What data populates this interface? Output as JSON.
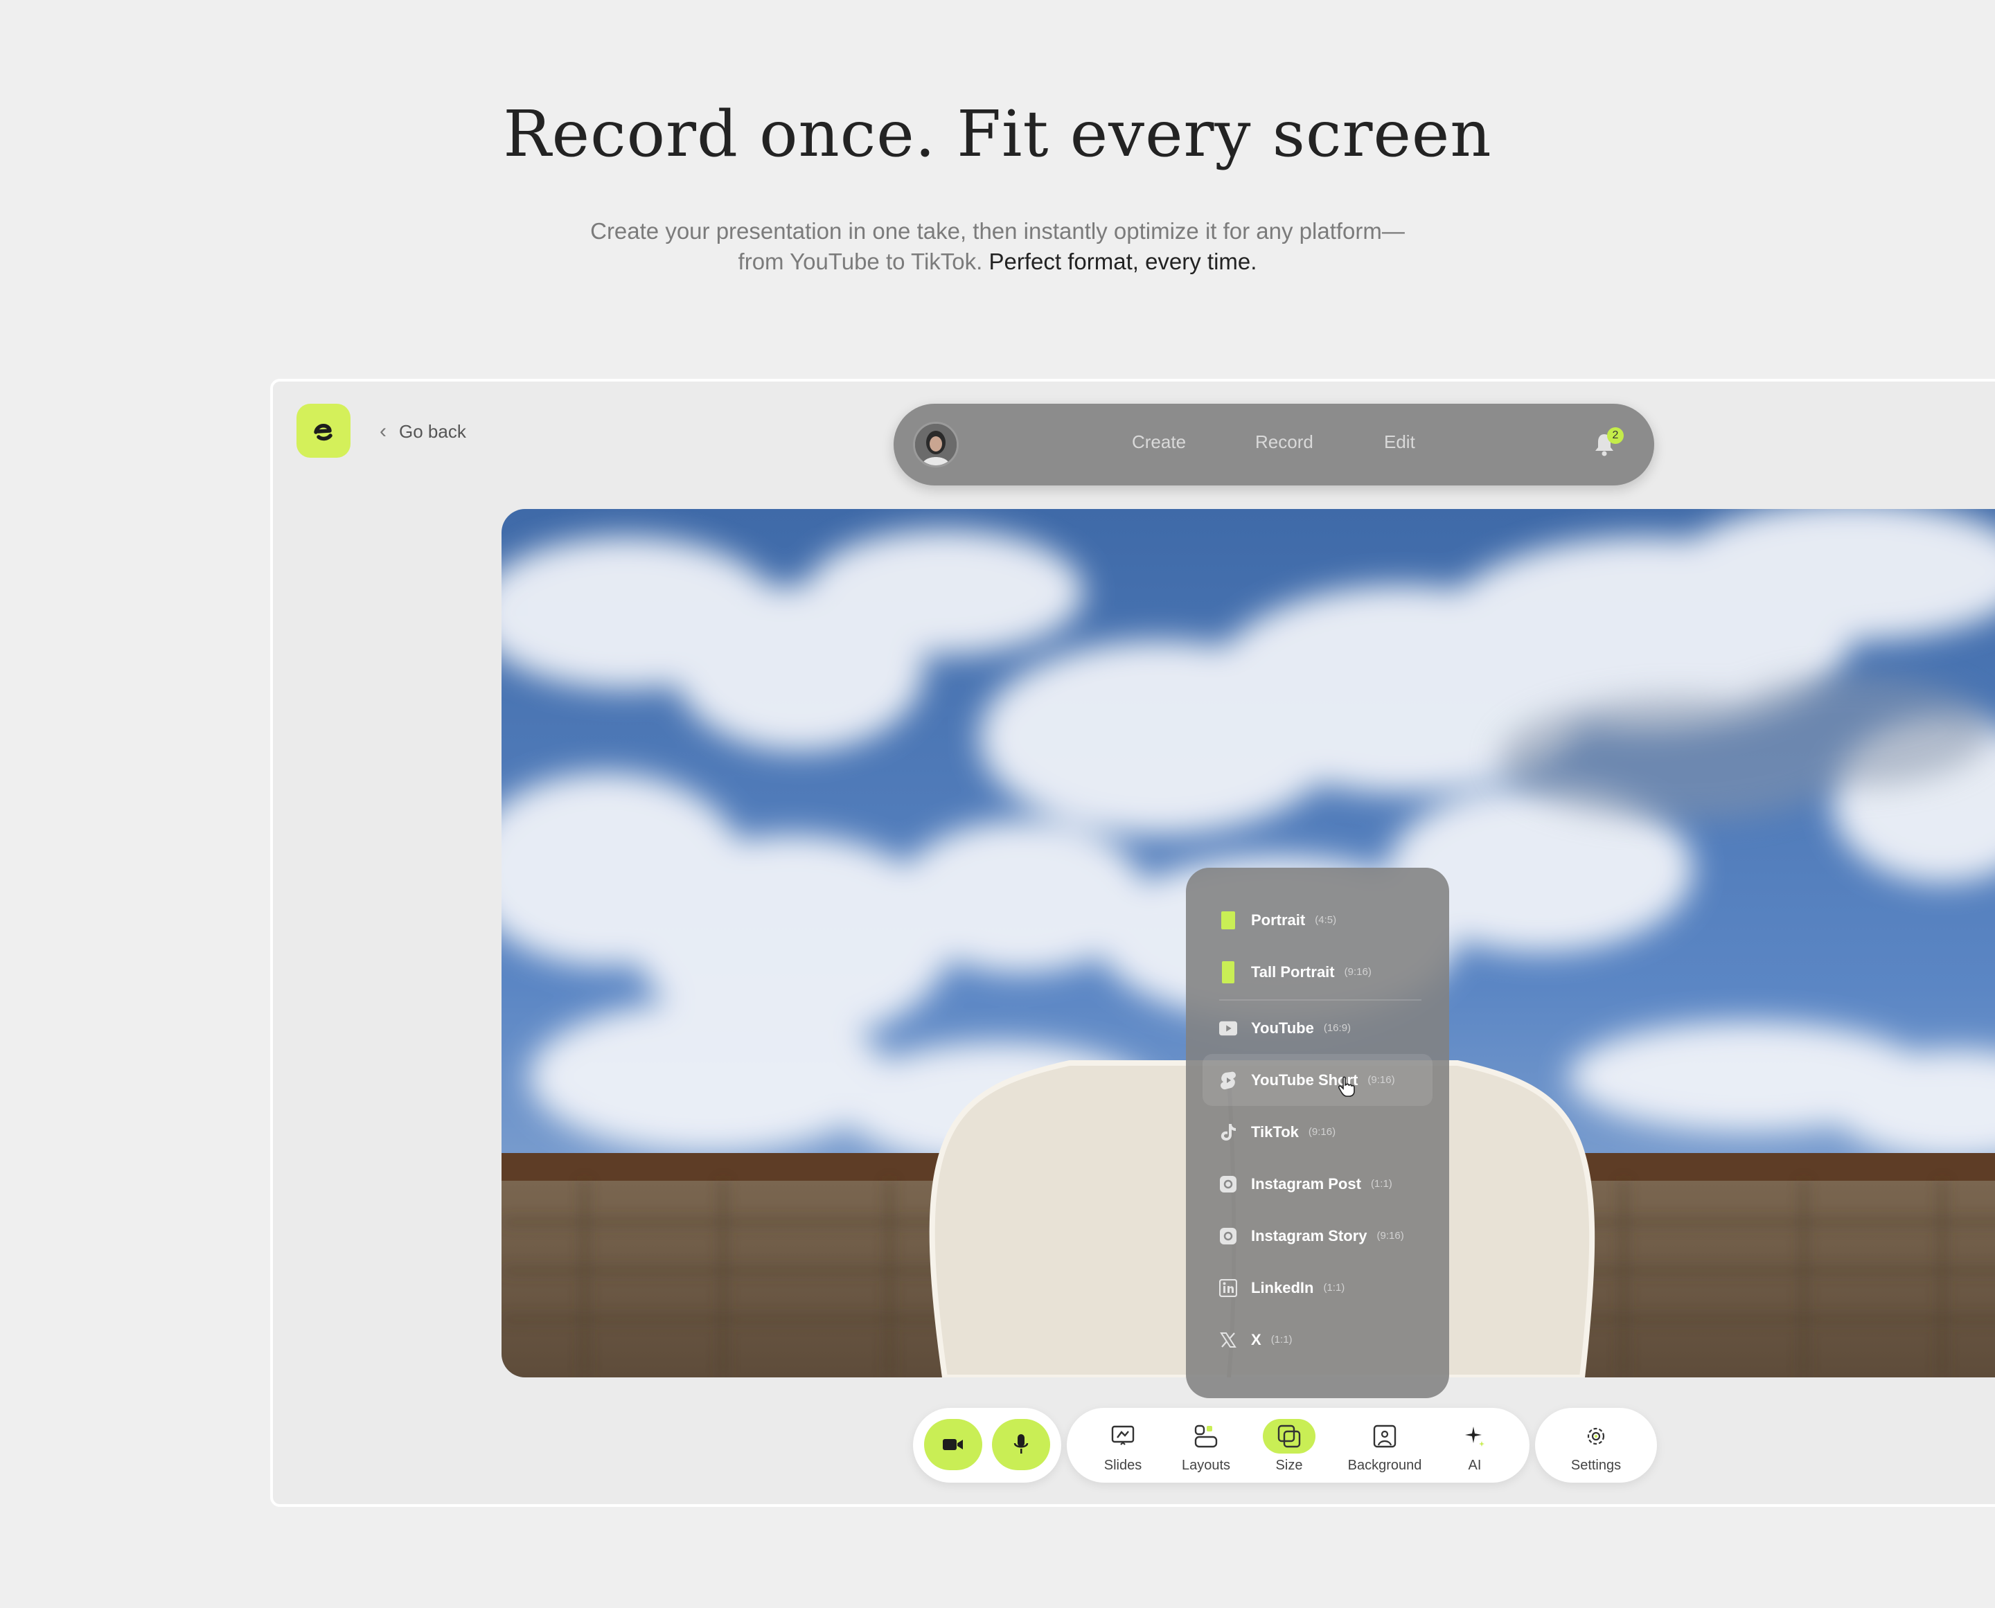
{
  "hero": {
    "title": "Record once. Fit every screen",
    "subtitle_line1": "Create your presentation in one take, then instantly optimize it for any platform—",
    "subtitle_line2": "from YouTube to TikTok. ",
    "subtitle_strong": "Perfect format, every time."
  },
  "header": {
    "go_back": "Go back"
  },
  "nav": {
    "items": [
      "Create",
      "Record",
      "Edit"
    ],
    "notification_count": "2"
  },
  "size_menu": {
    "items": [
      {
        "label": "Portrait",
        "ratio": "(4:5)",
        "icon": "portrait-icon"
      },
      {
        "label": "Tall Portrait",
        "ratio": "(9:16)",
        "icon": "tall-portrait-icon"
      },
      {
        "label": "YouTube",
        "ratio": "(16:9)",
        "icon": "youtube-icon"
      },
      {
        "label": "YouTube Short",
        "ratio": "(9:16)",
        "icon": "youtube-shorts-icon"
      },
      {
        "label": "TikTok",
        "ratio": "(9:16)",
        "icon": "tiktok-icon"
      },
      {
        "label": "Instagram Post",
        "ratio": "(1:1)",
        "icon": "instagram-icon"
      },
      {
        "label": "Instagram Story",
        "ratio": "(9:16)",
        "icon": "instagram-icon"
      },
      {
        "label": "LinkedIn",
        "ratio": "(1:1)",
        "icon": "linkedin-icon"
      },
      {
        "label": "X",
        "ratio": "(1:1)",
        "icon": "x-icon"
      }
    ],
    "hovered": "YouTube Short"
  },
  "toolbar": {
    "tools": [
      "Slides",
      "Layouts",
      "Size",
      "Background",
      "AI"
    ],
    "active_tool": "Size",
    "settings": "Settings"
  },
  "colors": {
    "accent": "#c9ee55",
    "background": "#efefef"
  }
}
